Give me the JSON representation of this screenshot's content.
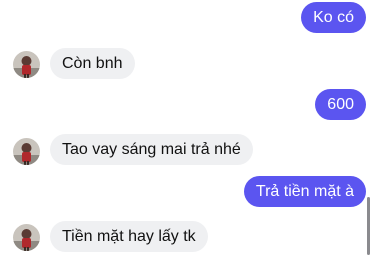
{
  "colors": {
    "sent_bubble": "#5b55f0",
    "received_bubble": "#eff0f2",
    "received_text": "#111111",
    "sent_text": "#ffffff"
  },
  "contact": {
    "avatar_icon": "contact-avatar-icon"
  },
  "messages": [
    {
      "direction": "sent",
      "text": "Ko có"
    },
    {
      "direction": "received",
      "text": "Còn bnh"
    },
    {
      "direction": "sent",
      "text": "600"
    },
    {
      "direction": "received",
      "text": "Tao vay sáng mai trả nhé"
    },
    {
      "direction": "sent",
      "text": "Trả tiền mặt à"
    },
    {
      "direction": "received",
      "text": "Tiền mặt hay lấy tk"
    }
  ]
}
